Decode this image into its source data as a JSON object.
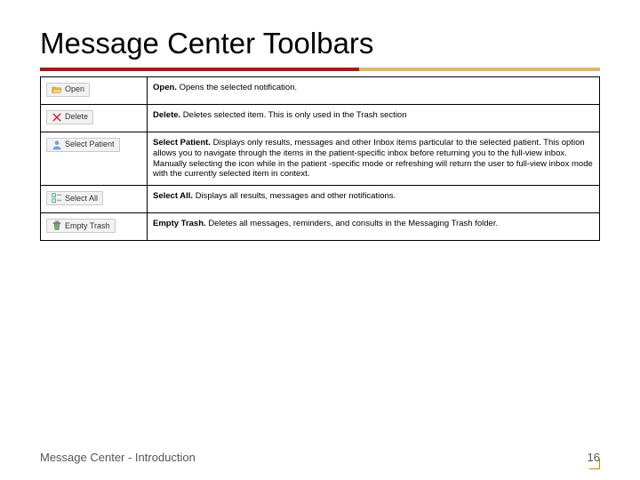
{
  "title": "Message Center Toolbars",
  "rows": [
    {
      "icon_label": "Open",
      "term": "Open.",
      "desc": "Opens the selected notification."
    },
    {
      "icon_label": "Delete",
      "term": "Delete.",
      "desc": "Deletes selected item. This is only used in the Trash section"
    },
    {
      "icon_label": "Select Patient",
      "term": "Select Patient.",
      "desc": "Displays only results, messages and other Inbox items particular to the selected patient. This option allows you to navigate through the items in the patient-specific inbox before returning you to the full-view inbox. Manually selecting the icon while in the patient -specific mode or refreshing will return the user to full-view inbox mode with the currently selected item in context."
    },
    {
      "icon_label": "Select All",
      "term": "Select All.",
      "desc": "Displays all results, messages and other notifications."
    },
    {
      "icon_label": "Empty Trash",
      "term": "Empty Trash.",
      "desc": "Deletes all messages, reminders, and consults in the Messaging Trash folder."
    }
  ],
  "footer": {
    "left": "Message Center - Introduction",
    "page": "16"
  }
}
